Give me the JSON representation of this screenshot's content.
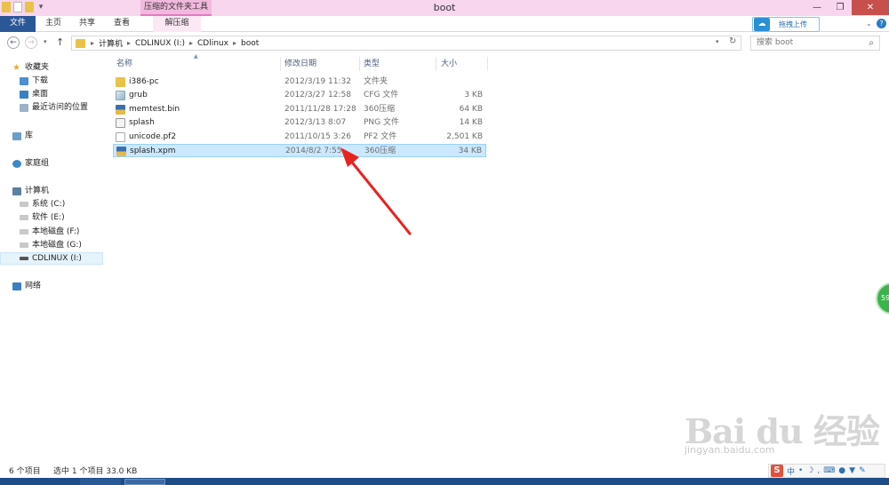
{
  "title_bar": {
    "contextual_tab_header": "压缩的文件夹工具",
    "window_title": "boot",
    "controls": {
      "minimize": "—",
      "maximize": "❐",
      "close": "✕"
    }
  },
  "ribbon": {
    "tabs": [
      "文件",
      "主页",
      "共享",
      "查看",
      "解压缩"
    ],
    "upload_button": "拖拽上传"
  },
  "address": {
    "breadcrumbs": [
      "计算机",
      "CDLINUX (I:)",
      "CDlinux",
      "boot"
    ],
    "search_placeholder": "搜索 boot"
  },
  "nav": {
    "favorites": "收藏夹",
    "favorites_items": [
      "下载",
      "桌面",
      "最近访问的位置"
    ],
    "libraries": "库",
    "homegroup": "家庭组",
    "computer": "计算机",
    "drives": [
      "系统 (C:)",
      "软件 (E:)",
      "本地磁盘 (F:)",
      "本地磁盘 (G:)",
      "CDLINUX (I:)"
    ],
    "network": "网络"
  },
  "columns": {
    "name": "名称",
    "date": "修改日期",
    "type": "类型",
    "size": "大小"
  },
  "files": [
    {
      "name": "i386-pc",
      "date": "2012/3/19 11:32",
      "type": "文件夹",
      "size": "",
      "icon": "folder-icon"
    },
    {
      "name": "grub",
      "date": "2012/3/27 12:58",
      "type": "CFG 文件",
      "size": "3 KB",
      "icon": "cfg-file-icon"
    },
    {
      "name": "memtest.bin",
      "date": "2011/11/28 17:28",
      "type": "360压缩",
      "size": "64 KB",
      "icon": "archive-icon"
    },
    {
      "name": "splash",
      "date": "2012/3/13 8:07",
      "type": "PNG 文件",
      "size": "14 KB",
      "icon": "png-file-icon"
    },
    {
      "name": "unicode.pf2",
      "date": "2011/10/15 3:26",
      "type": "PF2 文件",
      "size": "2,501 KB",
      "icon": "doc-file-icon"
    },
    {
      "name": "splash.xpm",
      "date": "2014/8/2 7:55",
      "type": "360压缩",
      "size": "34 KB",
      "icon": "archive-icon"
    }
  ],
  "status": {
    "item_count": "6 个项目",
    "selection": "选中 1 个项目  33.0 KB"
  },
  "side_widget": "59",
  "watermark": {
    "brand": "Bai du 经验",
    "url": "jingyan.baidu.com"
  },
  "ime": {
    "logo": "S",
    "mode": "中"
  }
}
